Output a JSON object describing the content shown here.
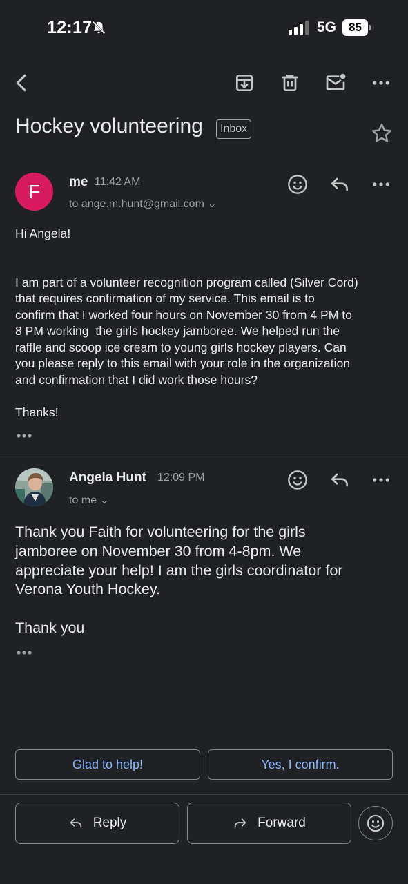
{
  "status": {
    "time": "12:17",
    "network": "5G",
    "battery": "85"
  },
  "subject": {
    "text": "Hockey volunteering",
    "label_chip": "Inbox"
  },
  "message1": {
    "avatar_letter": "F",
    "sender": "me",
    "time": "11:42 AM",
    "recipient": "to ange.m.hunt@gmail.com ⌄",
    "body": "Hi Angela!\n\n\nI am part of a volunteer recognition program called (Silver Cord)\nthat requires confirmation of my service. This email is to\nconfirm that I worked four hours on November 30 from 4 PM to\n8 PM working  the girls hockey jamboree. We helped run the\nraffle and scoop ice cream to young girls hockey players. Can\nyou please reply to this email with your role in the organization\nand confirmation that I did work those hours?\n\nThanks!"
  },
  "message2": {
    "sender": "Angela Hunt",
    "time": "12:09 PM",
    "recipient": "to me ⌄",
    "body": "Thank you Faith for volunteering for the girls\njamboree on November 30 from 4-8pm. We\nappreciate your help! I am the girls coordinator for\nVerona Youth Hockey.\n\nThank you"
  },
  "smart_replies": [
    "Glad to help!",
    "Yes, I confirm."
  ],
  "actions": {
    "reply": "Reply",
    "forward": "Forward"
  },
  "colors": {
    "background": "#202124",
    "avatar": "#d81b60",
    "link": "#8ab4f8",
    "text": "#e8eaed",
    "muted": "#9aa0a6"
  }
}
